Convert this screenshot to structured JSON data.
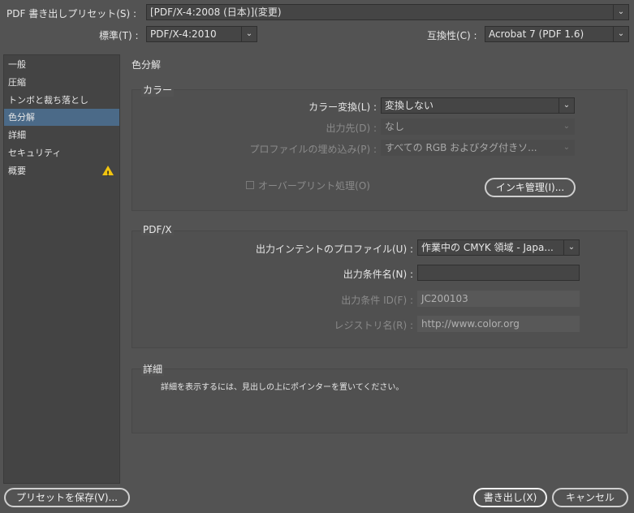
{
  "preset": {
    "label": "PDF 書き出しプリセット(S) :",
    "value": "[PDF/X-4:2008 (日本)](変更)"
  },
  "standard": {
    "label": "標準(T) :",
    "value": "PDF/X-4:2010"
  },
  "compat": {
    "label": "互換性(C) :",
    "value": "Acrobat 7 (PDF 1.6)"
  },
  "sidebar": {
    "items": [
      {
        "label": "一般"
      },
      {
        "label": "圧縮"
      },
      {
        "label": "トンボと裁ち落とし"
      },
      {
        "label": "色分解"
      },
      {
        "label": "詳細"
      },
      {
        "label": "セキュリティ"
      },
      {
        "label": "概要"
      }
    ]
  },
  "main": {
    "title": "色分解"
  },
  "color": {
    "title": "カラー",
    "conversion_label": "カラー変換(L) :",
    "conversion_value": "変換しない",
    "destination_label": "出力先(D) :",
    "destination_value": "なし",
    "profile_label": "プロファイルの埋め込み(P) :",
    "profile_value": "すべての RGB およびタグ付きソ...",
    "overprint_label": "オーバープリント処理(O)",
    "ink_button": "インキ管理(I)..."
  },
  "pdfx": {
    "title": "PDF/X",
    "intent_label": "出力インテントのプロファイル(U) :",
    "intent_value": "作業中の CMYK 領域 - Japa...",
    "condition_name_label": "出力条件名(N) :",
    "condition_name_value": "",
    "condition_id_label": "出力条件 ID(F) :",
    "condition_id_value": "JC200103",
    "registry_label": "レジストリ名(R) :",
    "registry_value": "http://www.color.org"
  },
  "details": {
    "title": "詳細",
    "text": "詳細を表示するには、見出しの上にポインターを置いてください。"
  },
  "buttons": {
    "save_preset": "プリセットを保存(V)...",
    "export": "書き出し(X)",
    "cancel": "キャンセル"
  }
}
